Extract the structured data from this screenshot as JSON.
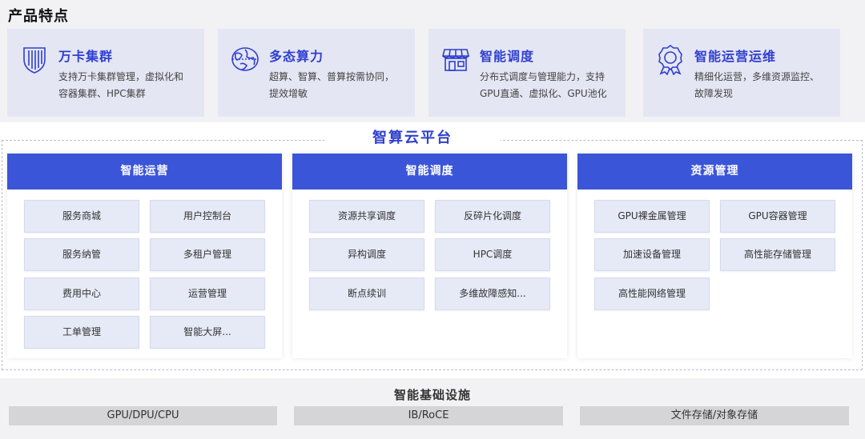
{
  "features": {
    "title": "产品特点",
    "items": [
      {
        "name": "万卡集群",
        "desc": "支持万卡集群管理，虚拟化和\n容器集群、HPC集群",
        "icon": "shield-icon"
      },
      {
        "name": "多态算力",
        "desc": "超算、智算、普算按需协同，\n提效增敏",
        "icon": "globe-icon"
      },
      {
        "name": "智能调度",
        "desc": "分布式调度与管理能力，支持\nGPU直通、虚拟化、GPU池化",
        "icon": "store-icon"
      },
      {
        "name": "智能运营运维",
        "desc": "精细化运营，多维资源监控、\n故障发现",
        "icon": "badge-icon"
      }
    ]
  },
  "platform": {
    "title": "智算云平台",
    "columns": [
      {
        "header": "智能运营",
        "modules": [
          "服务商城",
          "用户控制台",
          "服务纳管",
          "多租户管理",
          "费用中心",
          "运营管理",
          "工单管理",
          "智能大屏..."
        ]
      },
      {
        "header": "智能调度",
        "modules": [
          "资源共享调度",
          "反碎片化调度",
          "异构调度",
          "HPC调度",
          "断点续训",
          "多维故障感知..."
        ]
      },
      {
        "header": "资源管理",
        "modules": [
          "GPU裸金属管理",
          "GPU容器管理",
          "加速设备管理",
          "高性能存储管理",
          "高性能网络管理"
        ]
      }
    ]
  },
  "infrastructure": {
    "title": "智能基础设施",
    "items": [
      "GPU/DPU/CPU",
      "IB/RoCE",
      "文件存储/对象存储"
    ]
  },
  "colors": {
    "accent": "#2f3fd0",
    "header": "#3b55d9",
    "card": "#e4e6f3",
    "module": "#e6e9f6"
  }
}
